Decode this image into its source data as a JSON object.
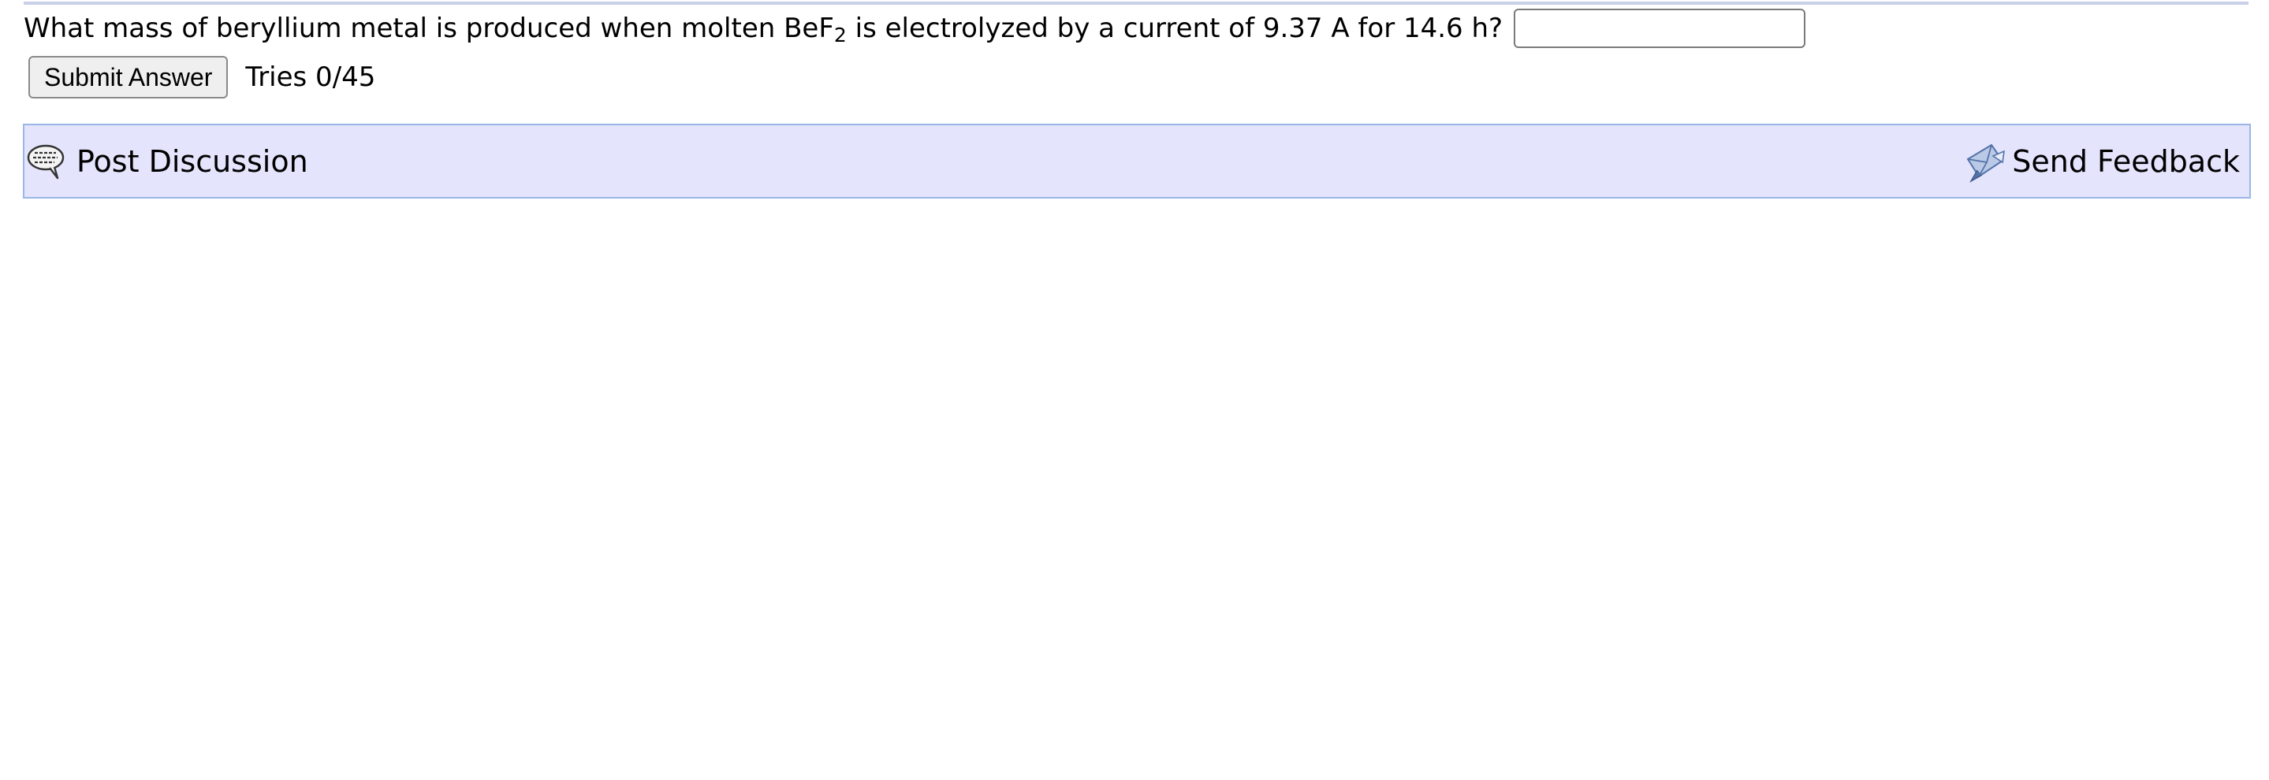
{
  "question": {
    "text_before": "What mass of beryllium metal is produced when molten BeF",
    "subscript": "2",
    "text_after": " is electrolyzed by a current of 9.37 A for 14.6 h?",
    "answer_value": "",
    "answer_placeholder": ""
  },
  "submit": {
    "button_label": "Submit Answer",
    "tries": "Tries 0/45"
  },
  "discussion_bar": {
    "post_label": "Post Discussion",
    "post_icon": "speech-bubble-icon",
    "feedback_label": "Send Feedback",
    "feedback_icon": "send-envelope-icon",
    "background_color": "#e4e4fd",
    "border_color": "#9ab6e6"
  }
}
